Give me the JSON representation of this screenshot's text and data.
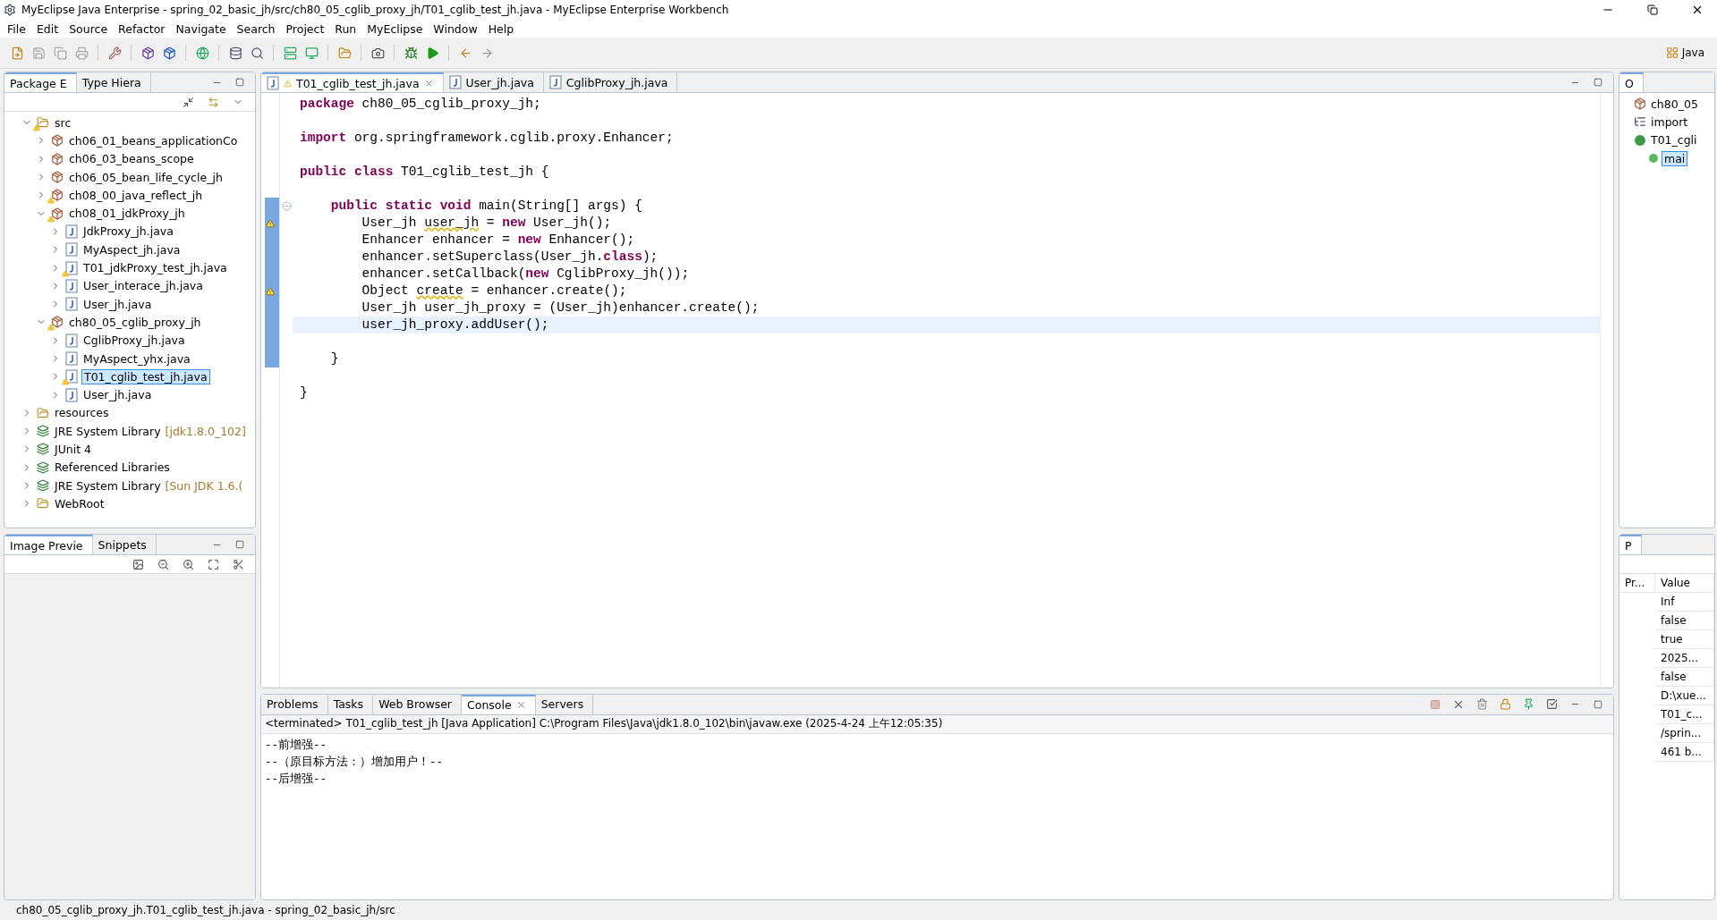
{
  "window": {
    "title": "MyEclipse Java Enterprise - spring_02_basic_jh/src/ch80_05_cglib_proxy_jh/T01_cglib_test_jh.java - MyEclipse Enterprise Workbench"
  },
  "menu": [
    "File",
    "Edit",
    "Source",
    "Refactor",
    "Navigate",
    "Search",
    "Project",
    "Run",
    "MyEclipse",
    "Window",
    "Help"
  ],
  "perspective": {
    "label": "Java"
  },
  "left_views": [
    {
      "label": "Package E",
      "selected": true
    },
    {
      "label": "Type Hiera",
      "selected": false
    }
  ],
  "package_tree": [
    {
      "label": "src",
      "kind": "source-folder",
      "warning": true,
      "expanded": true,
      "selected": false,
      "children": [
        {
          "label": "ch06_01_beans_applicationCo",
          "kind": "package",
          "warning": false,
          "expanded": false,
          "selected": false
        },
        {
          "label": "ch06_03_beans_scope",
          "kind": "package",
          "warning": false,
          "expanded": false,
          "selected": false
        },
        {
          "label": "ch06_05_bean_life_cycle_jh",
          "kind": "package",
          "warning": false,
          "expanded": false,
          "selected": false
        },
        {
          "label": "ch08_00_java_reflect_jh",
          "kind": "package",
          "warning": true,
          "expanded": false,
          "selected": false
        },
        {
          "label": "ch08_01_jdkProxy_jh",
          "kind": "package",
          "warning": true,
          "expanded": true,
          "selected": false,
          "children": [
            {
              "label": "JdkProxy_jh.java",
              "kind": "java-file",
              "warning": false,
              "expanded": false,
              "selected": false
            },
            {
              "label": "MyAspect_jh.java",
              "kind": "java-file",
              "warning": false,
              "expanded": false,
              "selected": false
            },
            {
              "label": "T01_jdkProxy_test_jh.java",
              "kind": "java-file",
              "warning": true,
              "expanded": false,
              "selected": false
            },
            {
              "label": "User_interace_jh.java",
              "kind": "java-file",
              "warning": false,
              "expanded": false,
              "selected": false
            },
            {
              "label": "User_jh.java",
              "kind": "java-file",
              "warning": false,
              "expanded": false,
              "selected": false
            }
          ]
        },
        {
          "label": "ch80_05_cglib_proxy_jh",
          "kind": "package",
          "warning": true,
          "expanded": true,
          "selected": false,
          "children": [
            {
              "label": "CglibProxy_jh.java",
              "kind": "java-file",
              "warning": false,
              "expanded": false,
              "selected": false
            },
            {
              "label": "MyAspect_yhx.java",
              "kind": "java-file",
              "warning": false,
              "expanded": false,
              "selected": false
            },
            {
              "label": "T01_cglib_test_jh.java",
              "kind": "java-file",
              "warning": true,
              "expanded": false,
              "selected": true
            },
            {
              "label": "User_jh.java",
              "kind": "java-file",
              "warning": false,
              "expanded": false,
              "selected": false
            }
          ]
        }
      ]
    },
    {
      "label": "resources",
      "kind": "source-folder",
      "warning": false,
      "expanded": false,
      "selected": false
    },
    {
      "label": "JRE System Library",
      "detail": "[jdk1.8.0_102]",
      "kind": "library",
      "warning": false,
      "expanded": false,
      "selected": false
    },
    {
      "label": "JUnit 4",
      "kind": "library",
      "warning": false,
      "expanded": false,
      "selected": false
    },
    {
      "label": "Referenced Libraries",
      "kind": "library",
      "warning": false,
      "expanded": false,
      "selected": false
    },
    {
      "label": "JRE System Library",
      "detail": "[Sun JDK 1.6.(",
      "kind": "library",
      "warning": false,
      "expanded": false,
      "selected": false
    },
    {
      "label": "WebRoot",
      "kind": "folder",
      "warning": false,
      "expanded": false,
      "selected": false
    }
  ],
  "lower_left_views": [
    {
      "label": "Image Previe",
      "selected": true
    },
    {
      "label": "Snippets",
      "selected": false
    }
  ],
  "editor_tabs": [
    {
      "label": "T01_cglib_test_jh.java",
      "selected": true,
      "warning": true
    },
    {
      "label": "User_jh.java",
      "selected": false,
      "warning": false
    },
    {
      "label": "CglibProxy_jh.java",
      "selected": false,
      "warning": false
    }
  ],
  "code": [
    {
      "current": false,
      "marker": false,
      "tokens": [
        {
          "t": "package",
          "kind": "keyword"
        },
        {
          "t": " ch80_05_cglib_proxy_jh;",
          "kind": "plain"
        }
      ]
    },
    {
      "current": false,
      "marker": false
    },
    {
      "current": false,
      "marker": false,
      "tokens": [
        {
          "t": "import",
          "kind": "keyword"
        },
        {
          "t": " org.springframework.cglib.proxy.Enhancer;",
          "kind": "plain"
        }
      ]
    },
    {
      "current": false,
      "marker": false
    },
    {
      "current": false,
      "marker": false,
      "tokens": [
        {
          "t": "public class",
          "kind": "keyword"
        },
        {
          "t": " T01_cglib_test_jh {",
          "kind": "plain"
        }
      ]
    },
    {
      "current": false,
      "marker": false
    },
    {
      "current": false,
      "marker": false,
      "fold": true,
      "tokens": [
        {
          "t": "    public static void",
          "kind": "keyword"
        },
        {
          "t": " main(String[] args) {",
          "kind": "plain"
        }
      ]
    },
    {
      "current": false,
      "marker": true,
      "tokens": [
        {
          "t": "        User_jh ",
          "kind": "plain"
        },
        {
          "t": "user_jh",
          "kind": "warning"
        },
        {
          "t": " = ",
          "kind": "plain"
        },
        {
          "t": "new",
          "kind": "keyword"
        },
        {
          "t": " User_jh();",
          "kind": "plain"
        }
      ]
    },
    {
      "current": false,
      "marker": false,
      "tokens": [
        {
          "t": "        Enhancer enhancer = ",
          "kind": "plain"
        },
        {
          "t": "new",
          "kind": "keyword"
        },
        {
          "t": " Enhancer();",
          "kind": "plain"
        }
      ]
    },
    {
      "current": false,
      "marker": false,
      "tokens": [
        {
          "t": "        enhancer.setSuperclass(User_jh.",
          "kind": "plain"
        },
        {
          "t": "class",
          "kind": "keyword"
        },
        {
          "t": ");",
          "kind": "plain"
        }
      ]
    },
    {
      "current": false,
      "marker": false,
      "tokens": [
        {
          "t": "        enhancer.setCallback(",
          "kind": "plain"
        },
        {
          "t": "new",
          "kind": "keyword"
        },
        {
          "t": " CglibProxy_jh());",
          "kind": "plain"
        }
      ]
    },
    {
      "current": false,
      "marker": true,
      "tokens": [
        {
          "t": "        Object ",
          "kind": "plain"
        },
        {
          "t": "create",
          "kind": "warning"
        },
        {
          "t": " = enhancer.create();",
          "kind": "plain"
        }
      ]
    },
    {
      "current": false,
      "marker": false,
      "tokens": [
        {
          "t": "        User_jh user_jh_proxy = (User_jh)enhancer.create();",
          "kind": "plain"
        }
      ]
    },
    {
      "current": true,
      "marker": false,
      "tokens": [
        {
          "t": "        user_jh_proxy.addUser();",
          "kind": "plain"
        }
      ]
    },
    {
      "current": false,
      "marker": false
    },
    {
      "current": false,
      "marker": false,
      "tokens": [
        {
          "t": "    }",
          "kind": "plain"
        }
      ]
    },
    {
      "current": false,
      "marker": false
    },
    {
      "current": false,
      "marker": false,
      "tokens": [
        {
          "t": "}",
          "kind": "plain"
        }
      ]
    }
  ],
  "bottom_tabs": [
    {
      "label": "Problems",
      "selected": false
    },
    {
      "label": "Tasks",
      "selected": false
    },
    {
      "label": "Web Browser",
      "selected": false
    },
    {
      "label": "Console",
      "selected": true
    },
    {
      "label": "Servers",
      "selected": false
    }
  ],
  "console": {
    "header": "<terminated> T01_cglib_test_jh [Java Application] C:\\Program Files\\Java\\jdk1.8.0_102\\bin\\javaw.exe (2025-4-24 上午12:05:35)",
    "lines": [
      "--前增强--",
      "--（原目标方法：）增加用户！--",
      "--后增强--"
    ]
  },
  "outline": {
    "tab": "O",
    "items": [
      {
        "label": "ch80_05",
        "kind": "package",
        "selected": false
      },
      {
        "label": "import",
        "kind": "imports",
        "selected": false
      },
      {
        "label": "T01_cgli",
        "kind": "class",
        "selected": false,
        "children": [
          {
            "label": "mai",
            "kind": "method",
            "selected": true
          }
        ]
      }
    ]
  },
  "properties": {
    "tab": "P",
    "columns": [
      "Pr...",
      "Value"
    ],
    "category": "Inf",
    "values": [
      "false",
      "true",
      "2025...",
      "false",
      "D:\\xue...",
      "T01_c...",
      "/sprin...",
      "461  b..."
    ]
  },
  "status_bar": {
    "text": "ch80_05_cglib_proxy_jh.T01_cglib_test_jh.java - spring_02_basic_jh/src"
  }
}
